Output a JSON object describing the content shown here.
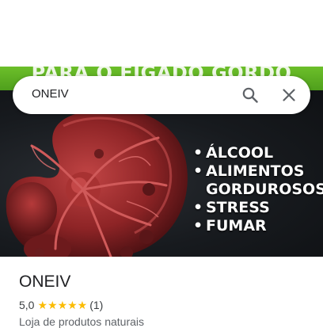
{
  "hero": {
    "banner_text": "PARA O FÍGADO GORDO",
    "bullets": [
      "ÁLCOOL",
      "ALIMENTOS",
      "GORDUROSOS",
      "STRESS",
      "FUMAR"
    ]
  },
  "search": {
    "query": "ONEIV",
    "search_icon": "search-icon",
    "close_icon": "close-icon"
  },
  "place": {
    "name": "ONEIV",
    "rating": "5,0",
    "stars": "★★★★★",
    "review_count": "(1)",
    "category": "Loja de produtos naturais"
  },
  "colors": {
    "banner_green": "#5aac22",
    "star_yellow": "#fbbc04",
    "kidney_red": "#9e2a2b"
  }
}
